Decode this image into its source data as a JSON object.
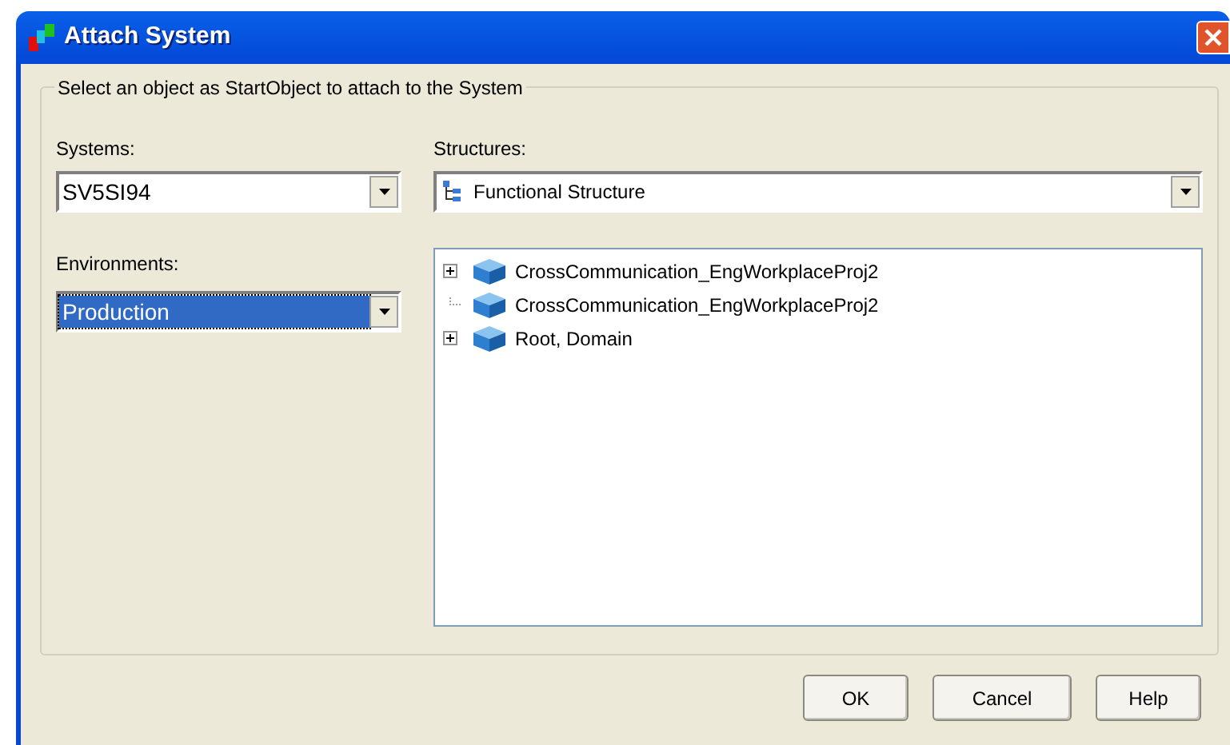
{
  "window": {
    "title": "Attach System"
  },
  "group": {
    "title": "Select an object as StartObject to attach to the System"
  },
  "systems": {
    "label": "Systems:",
    "value": "SV5SI94"
  },
  "environments": {
    "label": "Environments:",
    "value": "Production",
    "focused": true
  },
  "structures": {
    "label": "Structures:",
    "value": "Functional Structure"
  },
  "tree": {
    "items": [
      {
        "label": "CrossCommunication_EngWorkplaceProj2",
        "expandable": true
      },
      {
        "label": "CrossCommunication_EngWorkplaceProj2",
        "expandable": false
      },
      {
        "label": "Root, Domain",
        "expandable": true
      }
    ]
  },
  "buttons": [
    "OK",
    "Cancel",
    "Help"
  ]
}
